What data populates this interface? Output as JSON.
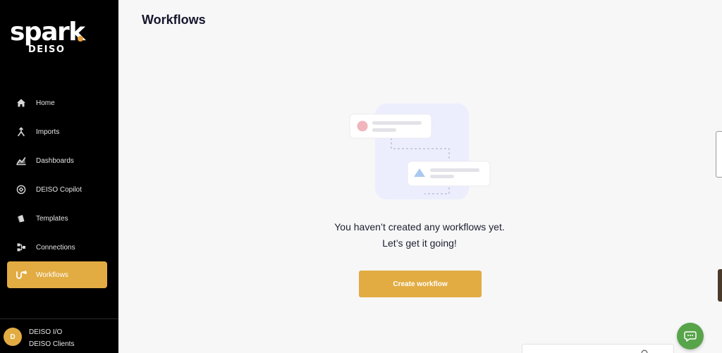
{
  "app": {
    "logo_text": "spark",
    "logo_subtext": "DEISO"
  },
  "sidebar": {
    "items": [
      {
        "label": "Home",
        "icon": "home-icon",
        "active": false
      },
      {
        "label": "Imports",
        "icon": "imports-icon",
        "active": false
      },
      {
        "label": "Dashboards",
        "icon": "dashboards-icon",
        "active": false
      },
      {
        "label": "DEISO Copilot",
        "icon": "copilot-icon",
        "active": false
      },
      {
        "label": "Templates",
        "icon": "templates-icon",
        "active": false
      },
      {
        "label": "Connections",
        "icon": "connections-icon",
        "active": false
      },
      {
        "label": "Workflows",
        "icon": "workflows-icon",
        "active": true
      }
    ]
  },
  "account": {
    "avatar_initial": "D",
    "line1": "DEISO I/O",
    "line2": "DEISO Clients"
  },
  "main": {
    "title": "Workflows",
    "empty_line1": "You haven’t created any workflows yet.",
    "empty_line2": "Let’s get it going!",
    "create_label": "Create workflow"
  },
  "colors": {
    "accent": "#e2ac43",
    "sidebar_bg": "#000000",
    "chat_button": "#58a44a",
    "logo_dot": "#e8a13a"
  },
  "icons": {
    "chat": "chat-bubble-icon",
    "search": "search-icon"
  }
}
